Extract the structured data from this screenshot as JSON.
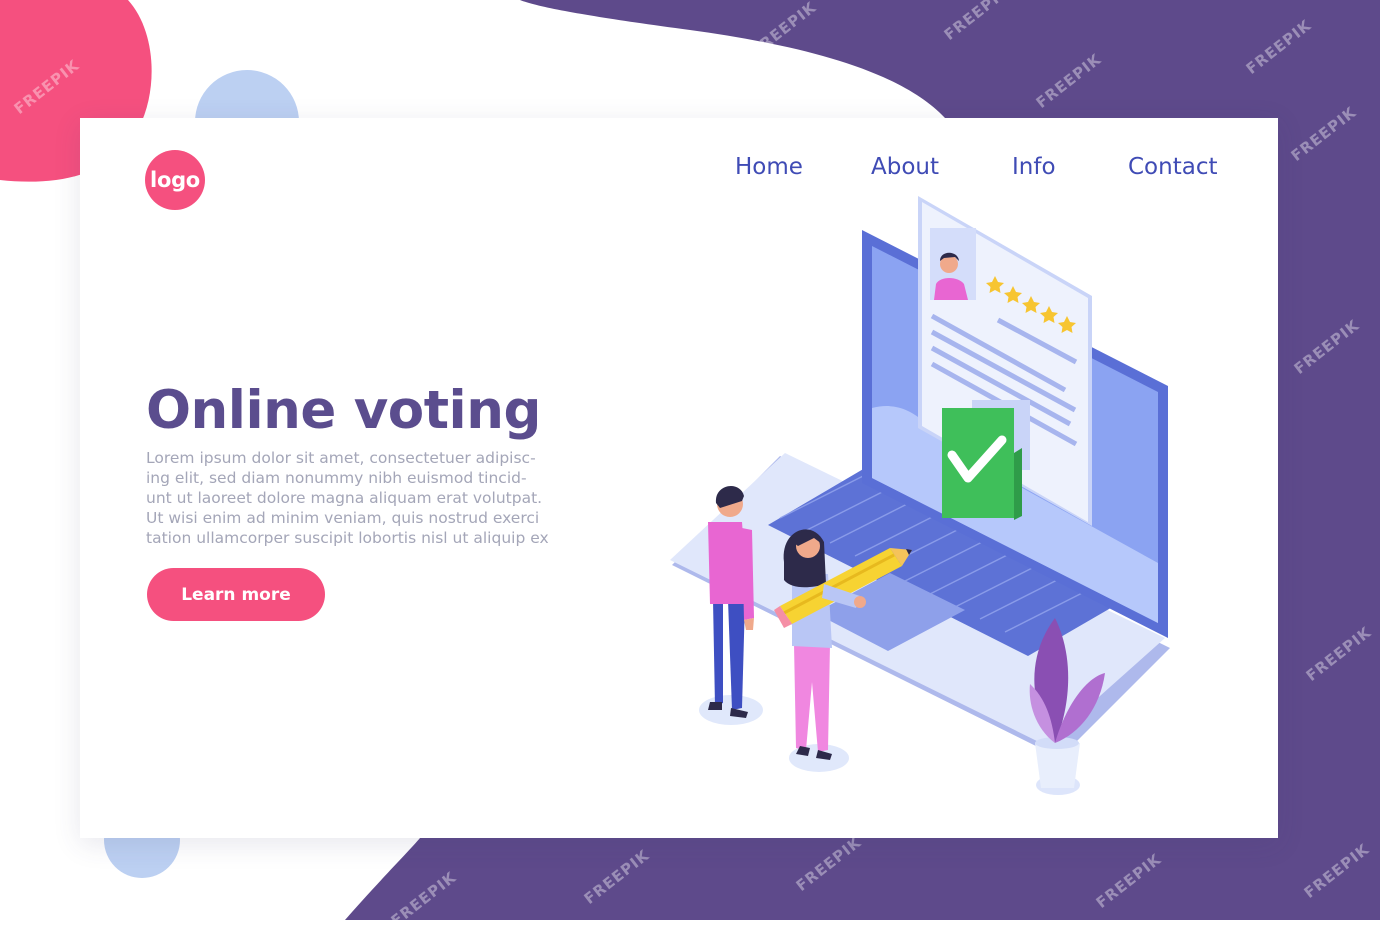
{
  "logo": {
    "label": "logo"
  },
  "nav": {
    "items": [
      {
        "label": "Home"
      },
      {
        "label": "About"
      },
      {
        "label": "Info"
      },
      {
        "label": "Contact"
      }
    ]
  },
  "hero": {
    "title": "Online voting",
    "body_lines": [
      "Lorem ipsum dolor sit amet, consectetuer adipisc-",
      "ing elit, sed diam nonummy nibh euismod tincid-",
      "unt ut laoreet dolore magna aliquam erat volutpat.",
      "Ut wisi enim ad minim veniam, quis nostrud exerci",
      "tation ullamcorper suscipit lobortis nisl ut aliquip ex"
    ],
    "cta_label": "Learn more"
  },
  "illustration": {
    "rating_stars": 5,
    "vote_status": "checked"
  },
  "watermark": {
    "text": "FREEPIK"
  },
  "colors": {
    "accent_pink": "#f5507f",
    "brand_purple": "#5e4a8b",
    "nav_blue": "#3f4bb5",
    "title_purple": "#5b4d8e",
    "body_gray": "#a4a6b8",
    "check_green": "#3fbf5a"
  }
}
